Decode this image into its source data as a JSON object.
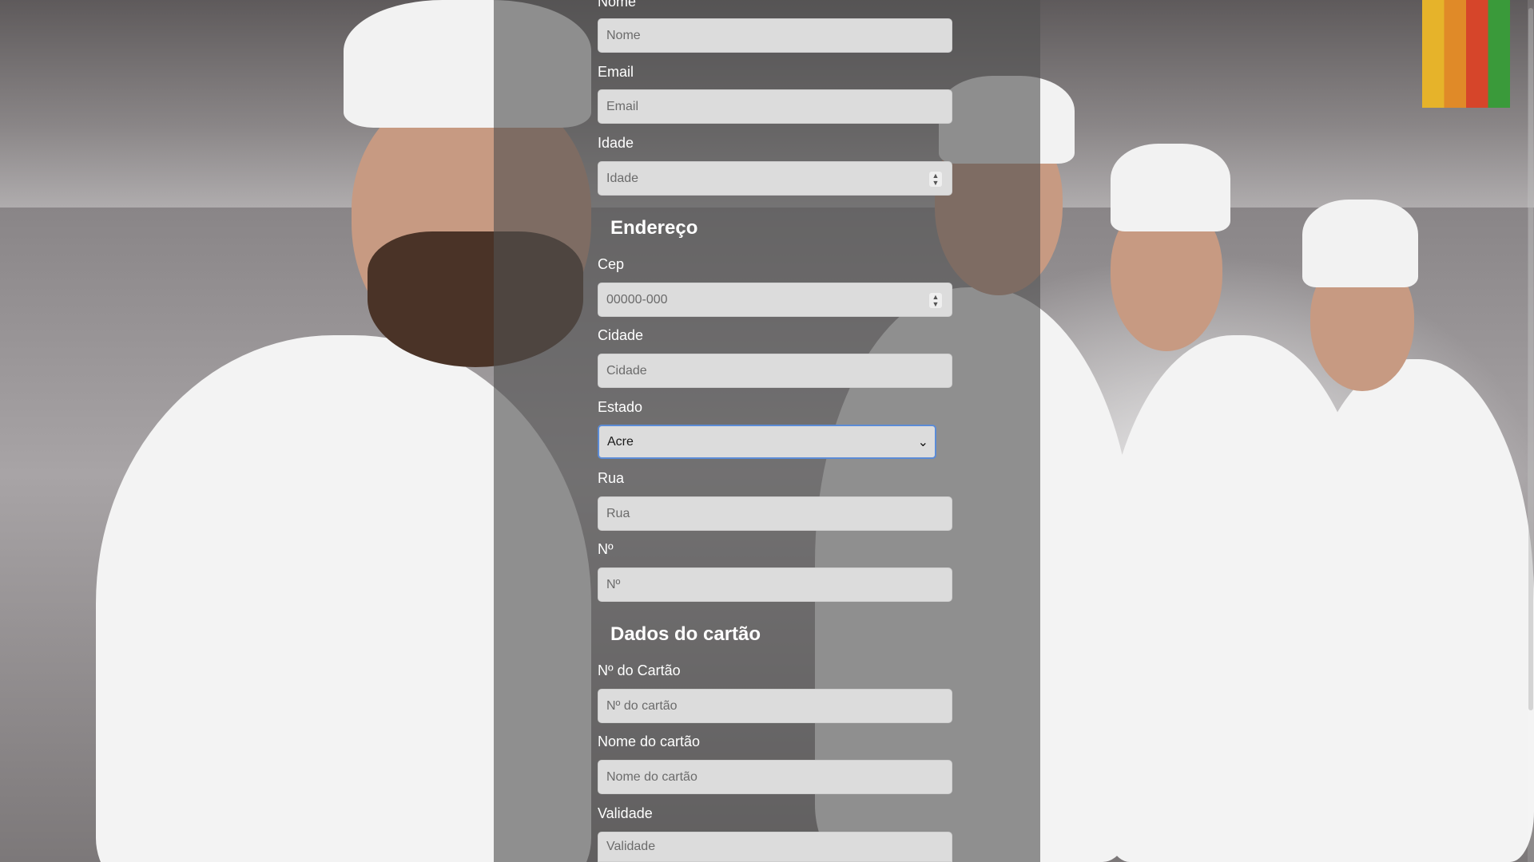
{
  "form": {
    "nome": {
      "label": "Nome",
      "placeholder": "Nome"
    },
    "email": {
      "label": "Email",
      "placeholder": "Email"
    },
    "idade": {
      "label": "Idade",
      "placeholder": "Idade"
    },
    "endereco_title": "Endereço",
    "cep": {
      "label": "Cep",
      "placeholder": "00000-000"
    },
    "cidade": {
      "label": "Cidade",
      "placeholder": "Cidade"
    },
    "estado": {
      "label": "Estado",
      "selected": "Acre"
    },
    "rua": {
      "label": "Rua",
      "placeholder": "Rua"
    },
    "numero": {
      "label": "Nº",
      "placeholder": "Nº"
    },
    "cartao_title": "Dados do cartão",
    "num_cartao": {
      "label": "Nº do Cartão",
      "placeholder": "Nº do cartão"
    },
    "nome_cartao": {
      "label": "Nome do cartão",
      "placeholder": "Nome do cartão"
    },
    "validade": {
      "label": "Validade",
      "placeholder": "Validade"
    }
  }
}
